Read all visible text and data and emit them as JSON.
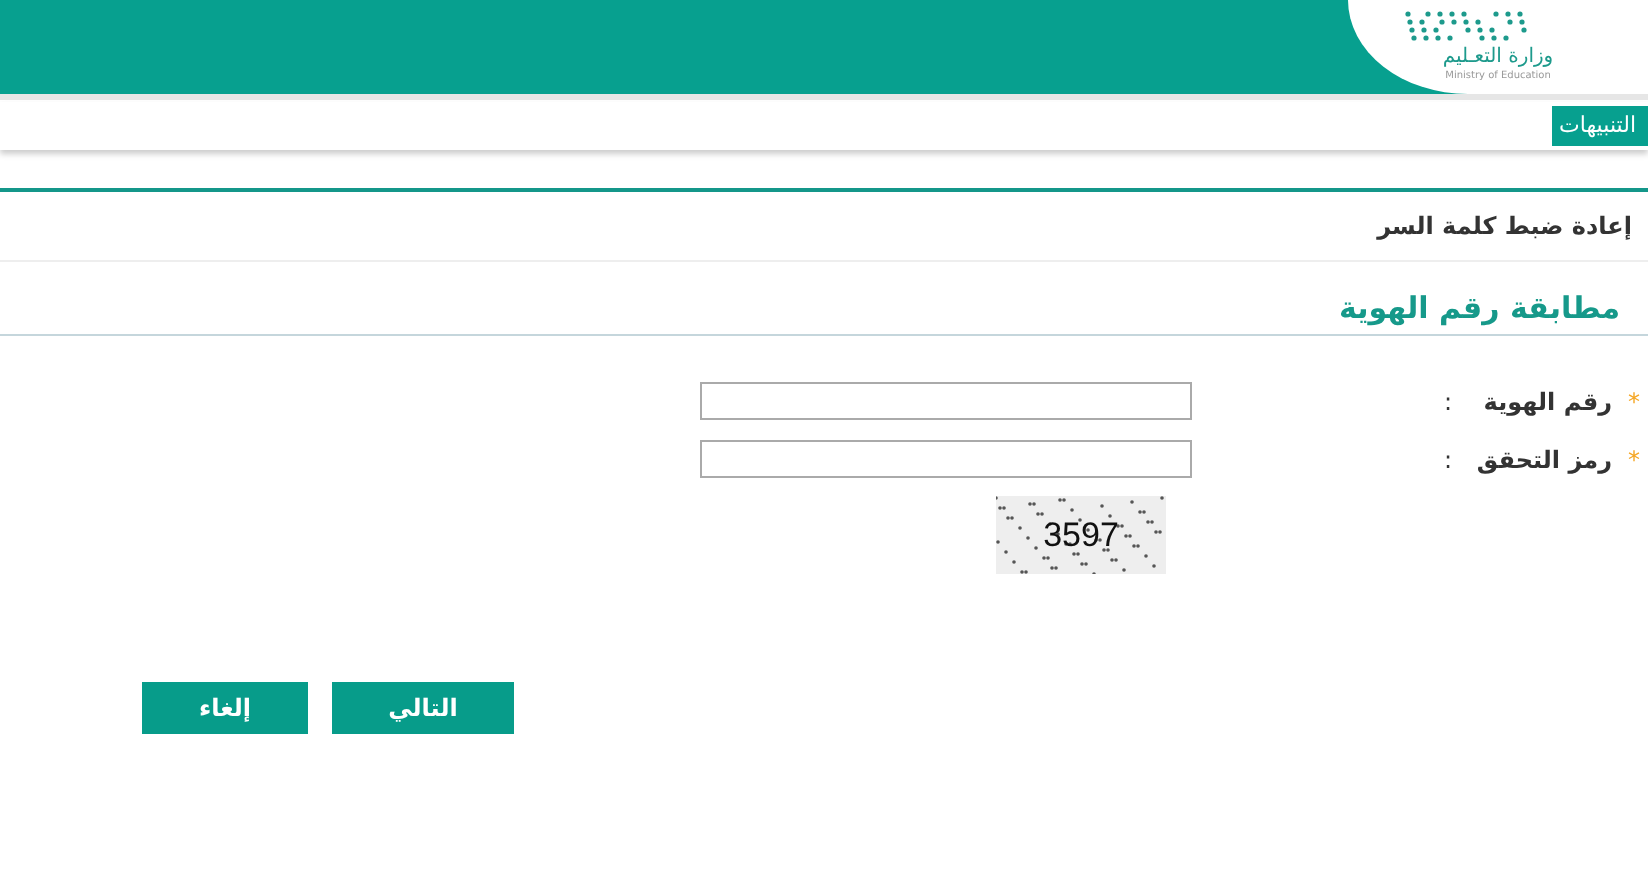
{
  "header": {
    "logo_text": "وزارة التعـليم",
    "logo_subtext": "Ministry of Education"
  },
  "notifications_tab": {
    "label": "التنبيهات"
  },
  "breadcrumb": "إعادة ضبط كلمة السر",
  "section_title": "مطابقة رقم الهوية",
  "fields": [
    {
      "label": "رقم الهوية",
      "required_mark": "*",
      "separator": ":"
    },
    {
      "label": "رمز التحقق",
      "required_mark": "*",
      "separator": ":"
    }
  ],
  "captcha": {
    "text": "3597"
  },
  "buttons": [
    {
      "label": "التالي"
    },
    {
      "label": "إلغاء"
    }
  ]
}
